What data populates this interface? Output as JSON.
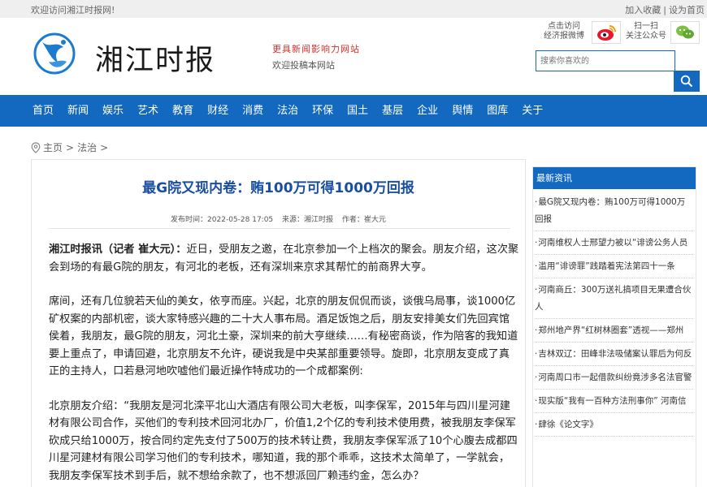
{
  "topbar": {
    "welcome": "欢迎访问湘江时报网!",
    "bookmark": "加入收藏",
    "sep": "|",
    "homepage": "设为首页"
  },
  "header": {
    "site_name": "湘江时报",
    "slogan": "更具新闻影响力网站",
    "submit_link": "欢迎投稿本网站",
    "weibo_line1": "点击访问",
    "weibo_line2": "经济报微博",
    "wechat_line1": "扫一扫",
    "wechat_line2": "关注公众号",
    "search_placeholder": "搜索你喜欢的"
  },
  "nav": {
    "items": [
      "首页",
      "新闻",
      "娱乐",
      "艺术",
      "教育",
      "财经",
      "消费",
      "法治",
      "环保",
      "国土",
      "基层",
      "企业",
      "舆情",
      "图库",
      "关于"
    ]
  },
  "breadcrumb": {
    "home": "主页",
    "sep1": ">",
    "section": "法治",
    "sep2": ">"
  },
  "article": {
    "title": "最G院又现内卷：贿100万可得1000万回报",
    "published_label": "发布时间：2022-05-28 17:05",
    "source_label": "来源：湘江时报",
    "author_label": "作者：崔大元",
    "lead_bold": "湘江时报讯（记者 崔大元）：",
    "lead_text": "近日，受朋友之邀，在北京参加一个上档次的聚会。朋友介绍，这次聚会到场的有最G院的朋友，有河北的老板，还有深圳来京求其帮忙的前商界大亨。",
    "para2": "席间，还有几位貌若天仙的美女，依亨而座。兴起，北京的朋友侃侃而谈，谈俄乌局事，谈1000亿矿权案的内部机密，谈大家特感兴趣的二十大人事布局。酒足饭饱之后，朋友安排美女们先回宾馆侯着，我朋友，最G院的朋友，河北土豪，深圳来的前大亨继续……有秘密商谈，作为陪客的我知道要上重点了，申请回避，北京朋友不允许，硬说我是中央某部重要领导。旋即，北京朋友变成了真正的主持人，口若悬河地吹嘘他们最近操作特成功的一个成都案例:",
    "para3": "北京朋友介绍：“我朋友是河北滦平北山大酒店有限公司大老板，叫李保军，2015年与四川星河建材有限公司合作，买他们的专利技术回河北办厂，价值1,2个亿的专利技术使用费，被我朋友李保军砍成只给1000万，按合同约定先支付了500万的技术转让费，我朋友李保军派了10个心腹去成都四川星河建材有限公司学习他们的专利技术，哪知道，我的那个乖乖，这技术太简单了，一学就会，我朋友李保军技术到手后，就不想给余款了，也不想派回厂赖违约金，怎么办？"
  },
  "sidebar": {
    "heading": "最新资讯",
    "items": [
      "最G院又现内卷：贿100万可得1000万回报",
      "河南维权人士邢望力被以“诽谤公务人员",
      "滥用“诽谤罪”践踏着宪法第四十一条",
      "河南商丘：300万送礼搞项目无果遭合伙人",
      "郑州地产界“红树林圈套”透视——郑州",
      "吉林双辽：田峰非法吸储案认罪后为何反",
      "河南周口市一起借款纠纷竟涉多名法官警",
      "现实版“我有一百种方法刑事你” 河南信",
      "肆徐《论文字》"
    ]
  }
}
